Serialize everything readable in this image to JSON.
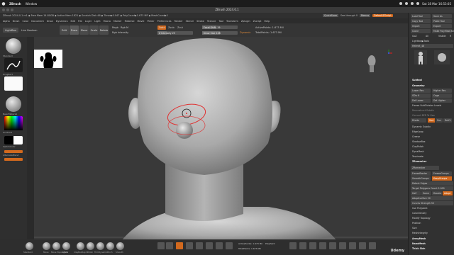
{
  "menubar": {
    "app_name": "ZBrush",
    "items": [
      "Window"
    ],
    "clock": "Sat 18 Mar  16:53:05"
  },
  "window": {
    "title": "ZBrush 2024.0.1"
  },
  "infobar": {
    "left_text": "ZBrush 2024.0.1 m1 ◆ Free Mem 14.80GB ◆ Active Mem 1821 ◆ Scratch Disk 46 ◆ Timer▶0.047 ◆ PolyCount▶1.673 MP ◆ MeshCount▶1",
    "quicksave": "QuickSave",
    "seethrough": "See-through  0",
    "menus": "Menus",
    "default_script": "DefaultZScript"
  },
  "main_menu": [
    "Alpha",
    "Brush",
    "Color",
    "Document",
    "Draw",
    "Dynamics",
    "Edit",
    "File",
    "Layer",
    "Light",
    "Macro",
    "Marker",
    "Material",
    "Movie",
    "Picker",
    "Preferences",
    "Render",
    "Stencil",
    "Stroke",
    "Texture",
    "Tool",
    "Transform",
    "Zplugin",
    "Zscript",
    "Help"
  ],
  "top_shelf": {
    "lightbox": "LightBox",
    "live_boolean": "Live Boolean",
    "edit": "Edit",
    "draw": "Draw",
    "move": "Move",
    "scale": "Scale",
    "rotate": "Rotate",
    "mrgb": "Mrgb",
    "rgb": "Rgb",
    "m": "M",
    "zadd": "Zadd",
    "zsub": "Zsub",
    "zcut": "Zcut",
    "rgb_intensity": "Rgb Intensity",
    "z_intensity": "Z Intensity 25",
    "focal_shift": "Focal Shift -19",
    "draw_size": "Draw Size 128",
    "dynamic": "Dynamic",
    "active_points": "ActivePoints: 1.673 Mil",
    "total_points": "TotalPoints: 1.673 Mil"
  },
  "left_tray": {
    "labels": [
      "Standard",
      "DragRect",
      "BasicMaterial",
      "Gradient",
      "SwitchColor",
      "AlternateBlend"
    ]
  },
  "bottom_bar": {
    "labels": [
      "Standard",
      "Move",
      "Move Topological",
      "Inflate",
      "ClayBuildup",
      "hPolish",
      "TrimDynamic",
      "Pinch",
      "Smooth"
    ],
    "active_points": "ActivePoints: 1.673 Mil",
    "total_points": "TotalPoints: 1.673 Mil",
    "polypaint": "PolyPaint"
  },
  "right_panel": {
    "header": [
      "Load Tool",
      "Save As",
      "Copy Tool",
      "Paste Tool",
      "Import",
      "Export",
      "Clone",
      "Make PolyMesh3D",
      "GoZ",
      "All",
      "Visible",
      "R"
    ],
    "lightbox_tools": "Lightbox▶Tools",
    "tool_name": "Helmet_48",
    "subtool": "Subtool",
    "geometry": "Geometry",
    "lower_res": "Lower Res",
    "higher_res": "Higher Res",
    "sdiv": "SDiv 6",
    "cage": "Cage",
    "del_lower": "Del Lower",
    "del_higher": "Del Higher",
    "freeze_subdiv": "Freeze SubDivision Levels",
    "reconstruct": "Reconstruct Subdiv",
    "convert_bpr": "Convert BPR To Geo",
    "divide": "Divide",
    "smt": "Smt",
    "suv": "Suv",
    "reuv": "ReUV",
    "dynamic_subdiv": "Dynamic Subdiv",
    "edgeloop": "EdgeLoop",
    "crease": "Crease",
    "shadowbox": "ShadowBox",
    "claypolish": "ClayPolish",
    "dynamesh": "DynaMesh",
    "tessimate": "Tessimate",
    "zremesher": "ZRemesher",
    "zremesher_btn": "ZRemesher",
    "freeze_border": "FreezeBorder",
    "freeze_groups": "FreezeGroups",
    "smooth_groups": "SmoothGroups",
    "keep_groups": "KeepGroups",
    "detect_edges": "Detect Edges",
    "target_polygons": "Target Polygons Count 5.000",
    "half": "Half",
    "same": "Same",
    "double": "Double",
    "adapt": "Adapt",
    "adaptive_size": "AdaptiveSize 50",
    "curves_strength": "Curves Strength 50",
    "use_polypaint": "Use Polypaint",
    "color_density": "ColorDensity",
    "modify_topology": "Modify Topology",
    "position": "Position",
    "size": "Size",
    "mesh_integrity": "MeshIntegrity",
    "array_mesh": "ArrayMesh",
    "nanomesh": "NanoMesh",
    "thick_skin": "Thick Skin",
    "layers": "Layers",
    "fibermesh": "FiberMesh",
    "geometry_hd": "Geometry HD",
    "preview": "Preview",
    "surface": "Surface",
    "deformation": "Deformation"
  },
  "watermark": "Udemy"
}
